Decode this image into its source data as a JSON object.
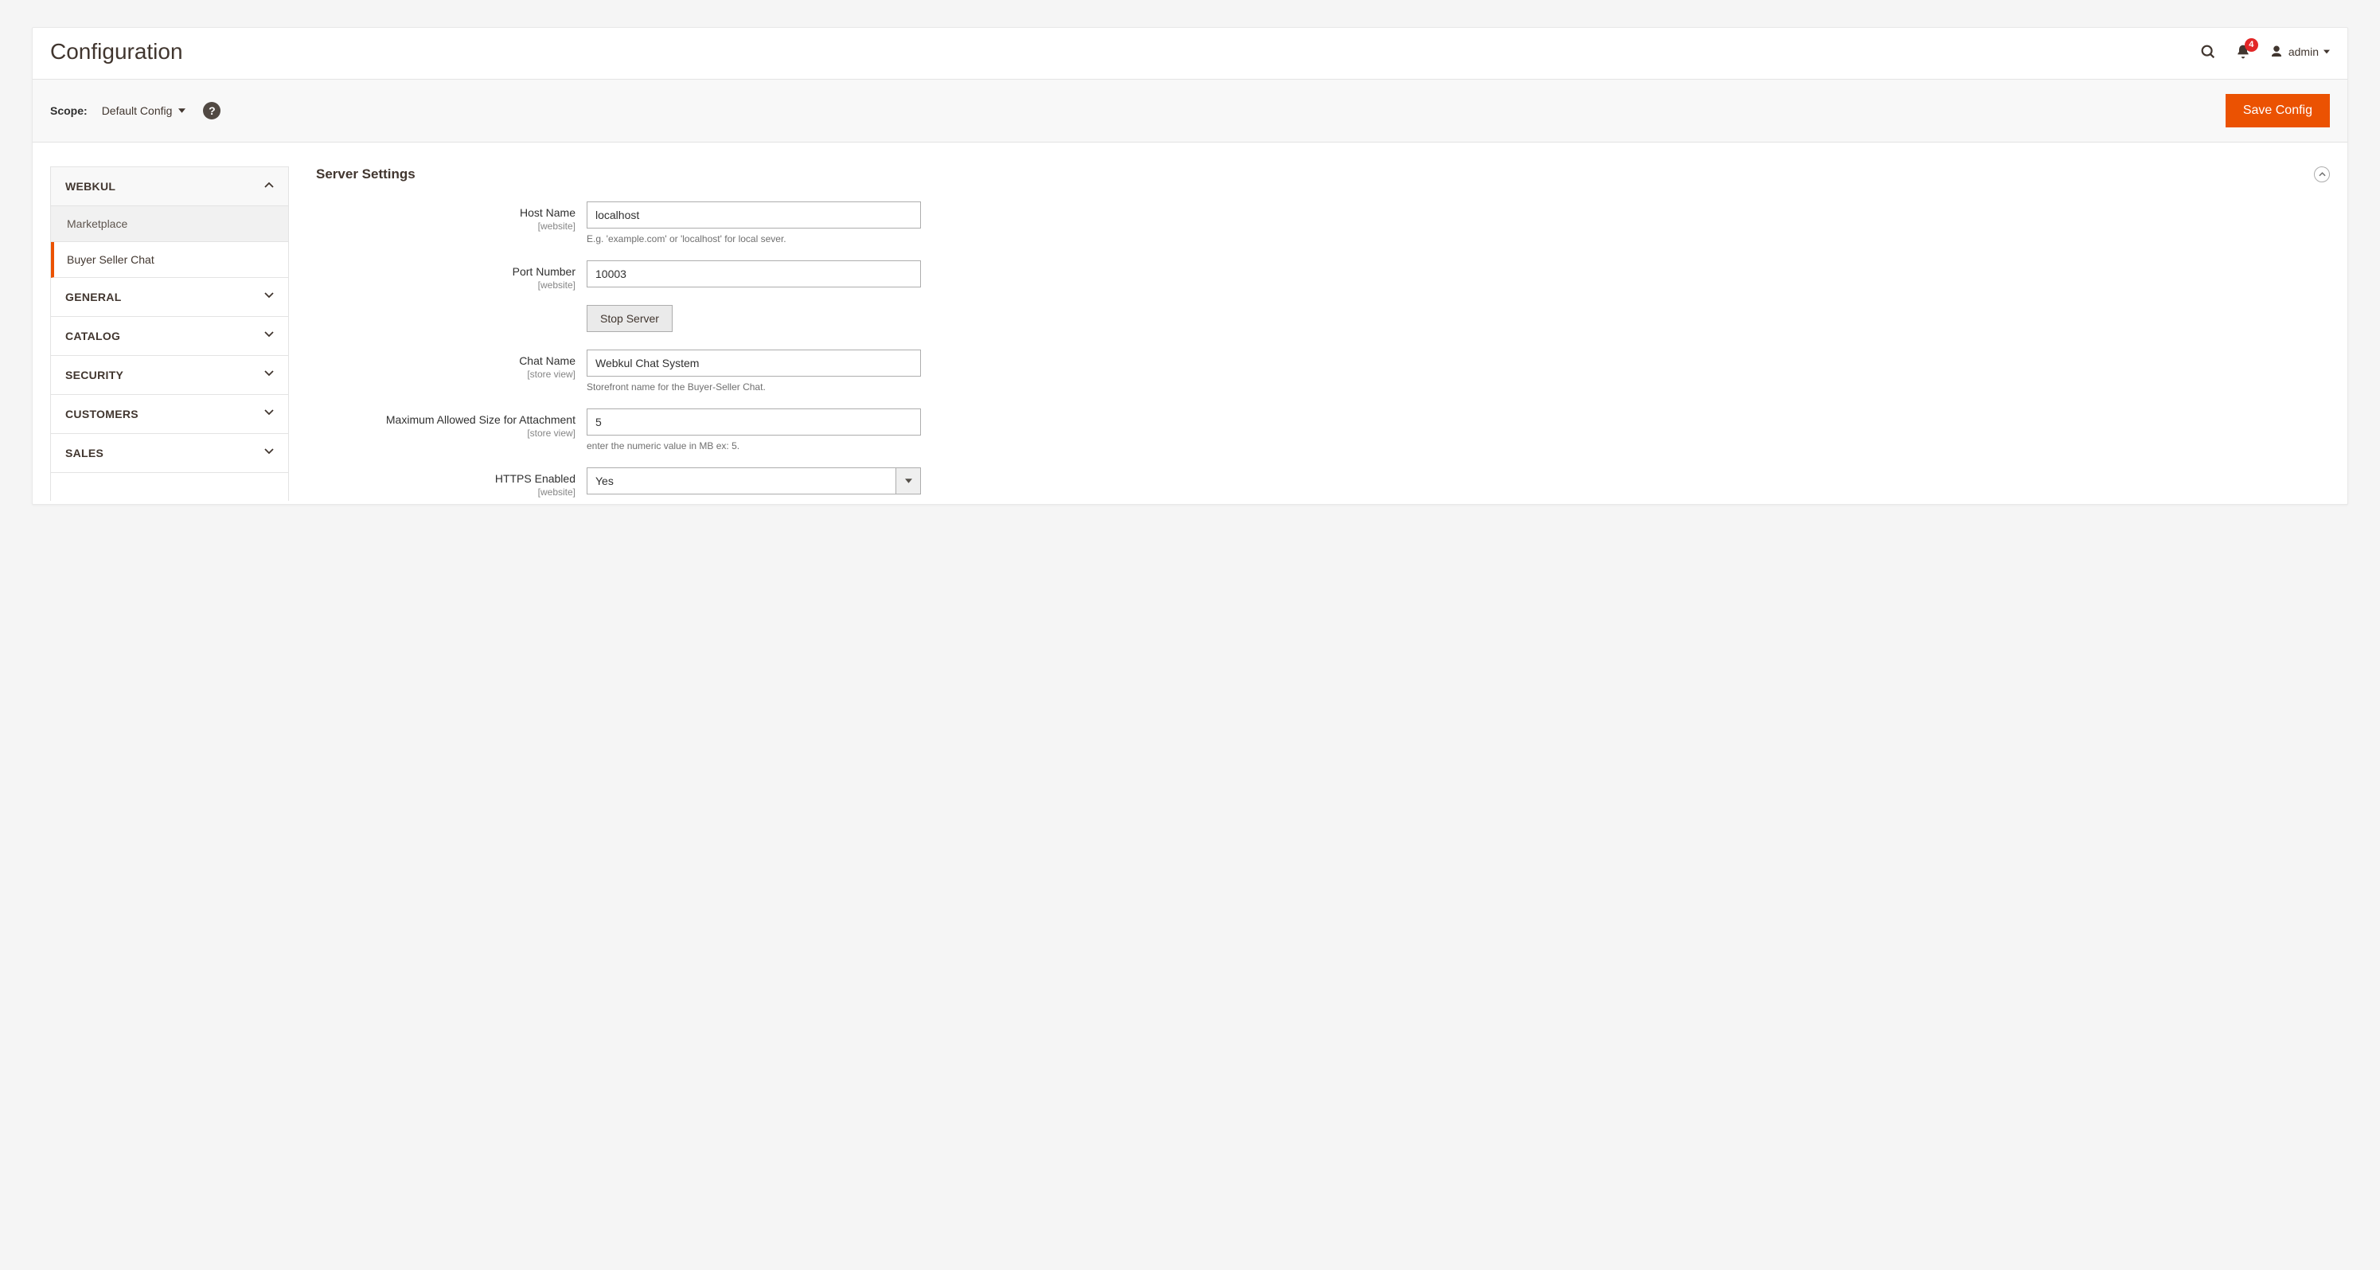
{
  "header": {
    "title": "Configuration",
    "notification_count": "4",
    "username": "admin"
  },
  "scope": {
    "label": "Scope:",
    "current": "Default Config"
  },
  "actions": {
    "save": "Save Config"
  },
  "sidebar": {
    "groups": [
      {
        "label": "WEBKUL",
        "expanded": true,
        "items": [
          {
            "label": "Marketplace",
            "active": false
          },
          {
            "label": "Buyer Seller Chat",
            "active": true
          }
        ]
      },
      {
        "label": "GENERAL",
        "expanded": false
      },
      {
        "label": "CATALOG",
        "expanded": false
      },
      {
        "label": "SECURITY",
        "expanded": false
      },
      {
        "label": "CUSTOMERS",
        "expanded": false
      },
      {
        "label": "SALES",
        "expanded": false
      }
    ]
  },
  "section": {
    "title": "Server Settings"
  },
  "fields": {
    "host_name": {
      "label": "Host Name",
      "scope": "[website]",
      "value": "localhost",
      "hint": "E.g. 'example.com' or 'localhost' for local sever."
    },
    "port_number": {
      "label": "Port Number",
      "scope": "[website]",
      "value": "10003"
    },
    "stop_server": {
      "label": "Stop Server"
    },
    "chat_name": {
      "label": "Chat Name",
      "scope": "[store view]",
      "value": "Webkul Chat System",
      "hint": "Storefront name for the Buyer-Seller Chat."
    },
    "max_attach": {
      "label": "Maximum Allowed Size for Attachment",
      "scope": "[store view]",
      "value": "5",
      "hint": "enter the numeric value in MB ex: 5."
    },
    "https_enabled": {
      "label": "HTTPS Enabled",
      "scope": "[website]",
      "value": "Yes"
    }
  }
}
